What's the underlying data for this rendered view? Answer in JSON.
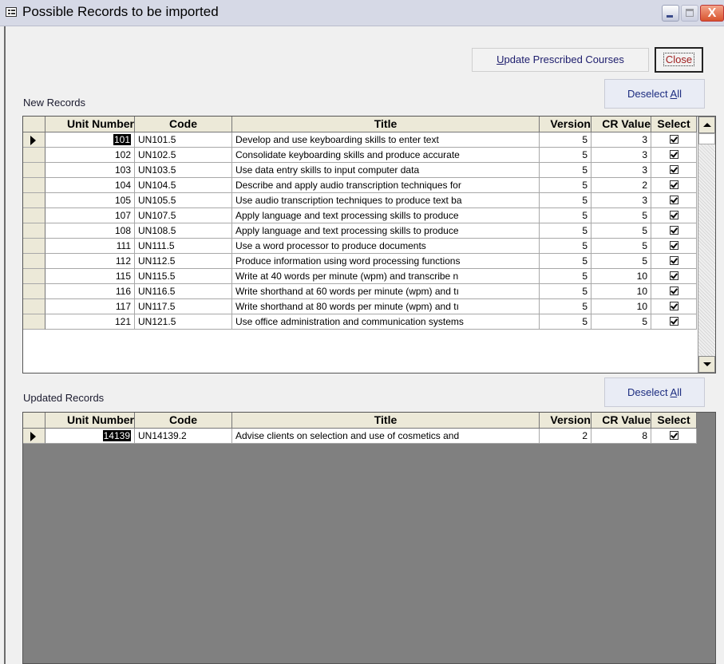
{
  "window": {
    "title": "Possible Records to be imported",
    "close_glyph": "X"
  },
  "toolbar": {
    "update_label_accel": "U",
    "update_label_rest": "pdate Prescribed Courses",
    "close_label": "Close"
  },
  "new_records": {
    "label": "New Records",
    "deselect_prefix": "Deselect ",
    "deselect_accel": "A",
    "deselect_suffix": "ll",
    "columns": [
      "Unit Number",
      "Code",
      "Title",
      "Version",
      "CR Value",
      "Select"
    ],
    "rows": [
      {
        "unit": "101",
        "code": "UN101.5",
        "title": "Develop and use keyboarding skills to enter text",
        "version": "5",
        "cr": "3",
        "selected": true
      },
      {
        "unit": "102",
        "code": "UN102.5",
        "title": "Consolidate keyboarding skills and produce accurate",
        "version": "5",
        "cr": "3",
        "selected": true
      },
      {
        "unit": "103",
        "code": "UN103.5",
        "title": "Use data entry skills to input computer data",
        "version": "5",
        "cr": "3",
        "selected": true
      },
      {
        "unit": "104",
        "code": "UN104.5",
        "title": "Describe and apply audio transcription techniques for",
        "version": "5",
        "cr": "2",
        "selected": true
      },
      {
        "unit": "105",
        "code": "UN105.5",
        "title": "Use audio transcription techniques to produce text ba",
        "version": "5",
        "cr": "3",
        "selected": true
      },
      {
        "unit": "107",
        "code": "UN107.5",
        "title": "Apply language and text processing skills to produce",
        "version": "5",
        "cr": "5",
        "selected": true
      },
      {
        "unit": "108",
        "code": "UN108.5",
        "title": "Apply language and text processing skills to produce",
        "version": "5",
        "cr": "5",
        "selected": true
      },
      {
        "unit": "111",
        "code": "UN111.5",
        "title": "Use a word processor to produce documents",
        "version": "5",
        "cr": "5",
        "selected": true
      },
      {
        "unit": "112",
        "code": "UN112.5",
        "title": "Produce information using word processing functions",
        "version": "5",
        "cr": "5",
        "selected": true
      },
      {
        "unit": "115",
        "code": "UN115.5",
        "title": "Write at 40 words per minute (wpm) and transcribe n",
        "version": "5",
        "cr": "10",
        "selected": true
      },
      {
        "unit": "116",
        "code": "UN116.5",
        "title": "Write shorthand at 60 words per minute (wpm) and tı",
        "version": "5",
        "cr": "10",
        "selected": true
      },
      {
        "unit": "117",
        "code": "UN117.5",
        "title": "Write shorthand at 80 words per minute (wpm) and tı",
        "version": "5",
        "cr": "10",
        "selected": true
      },
      {
        "unit": "121",
        "code": "UN121.5",
        "title": "Use office administration and communication systems",
        "version": "5",
        "cr": "5",
        "selected": true
      }
    ]
  },
  "updated_records": {
    "label": "Updated Records",
    "deselect_prefix": "Deselect ",
    "deselect_accel": "A",
    "deselect_suffix": "ll",
    "columns": [
      "Unit Number",
      "Code",
      "Title",
      "Version",
      "CR Value",
      "Select"
    ],
    "rows": [
      {
        "unit": "14139",
        "code": "UN14139.2",
        "title": "Advise clients on selection and use of cosmetics and",
        "version": "2",
        "cr": "8",
        "selected": true
      }
    ]
  },
  "colors": {
    "title_bar": "#d6d9e6",
    "grid_empty": "#808080",
    "header_bg": "#ece9d8",
    "close_button": "#d8542e"
  }
}
